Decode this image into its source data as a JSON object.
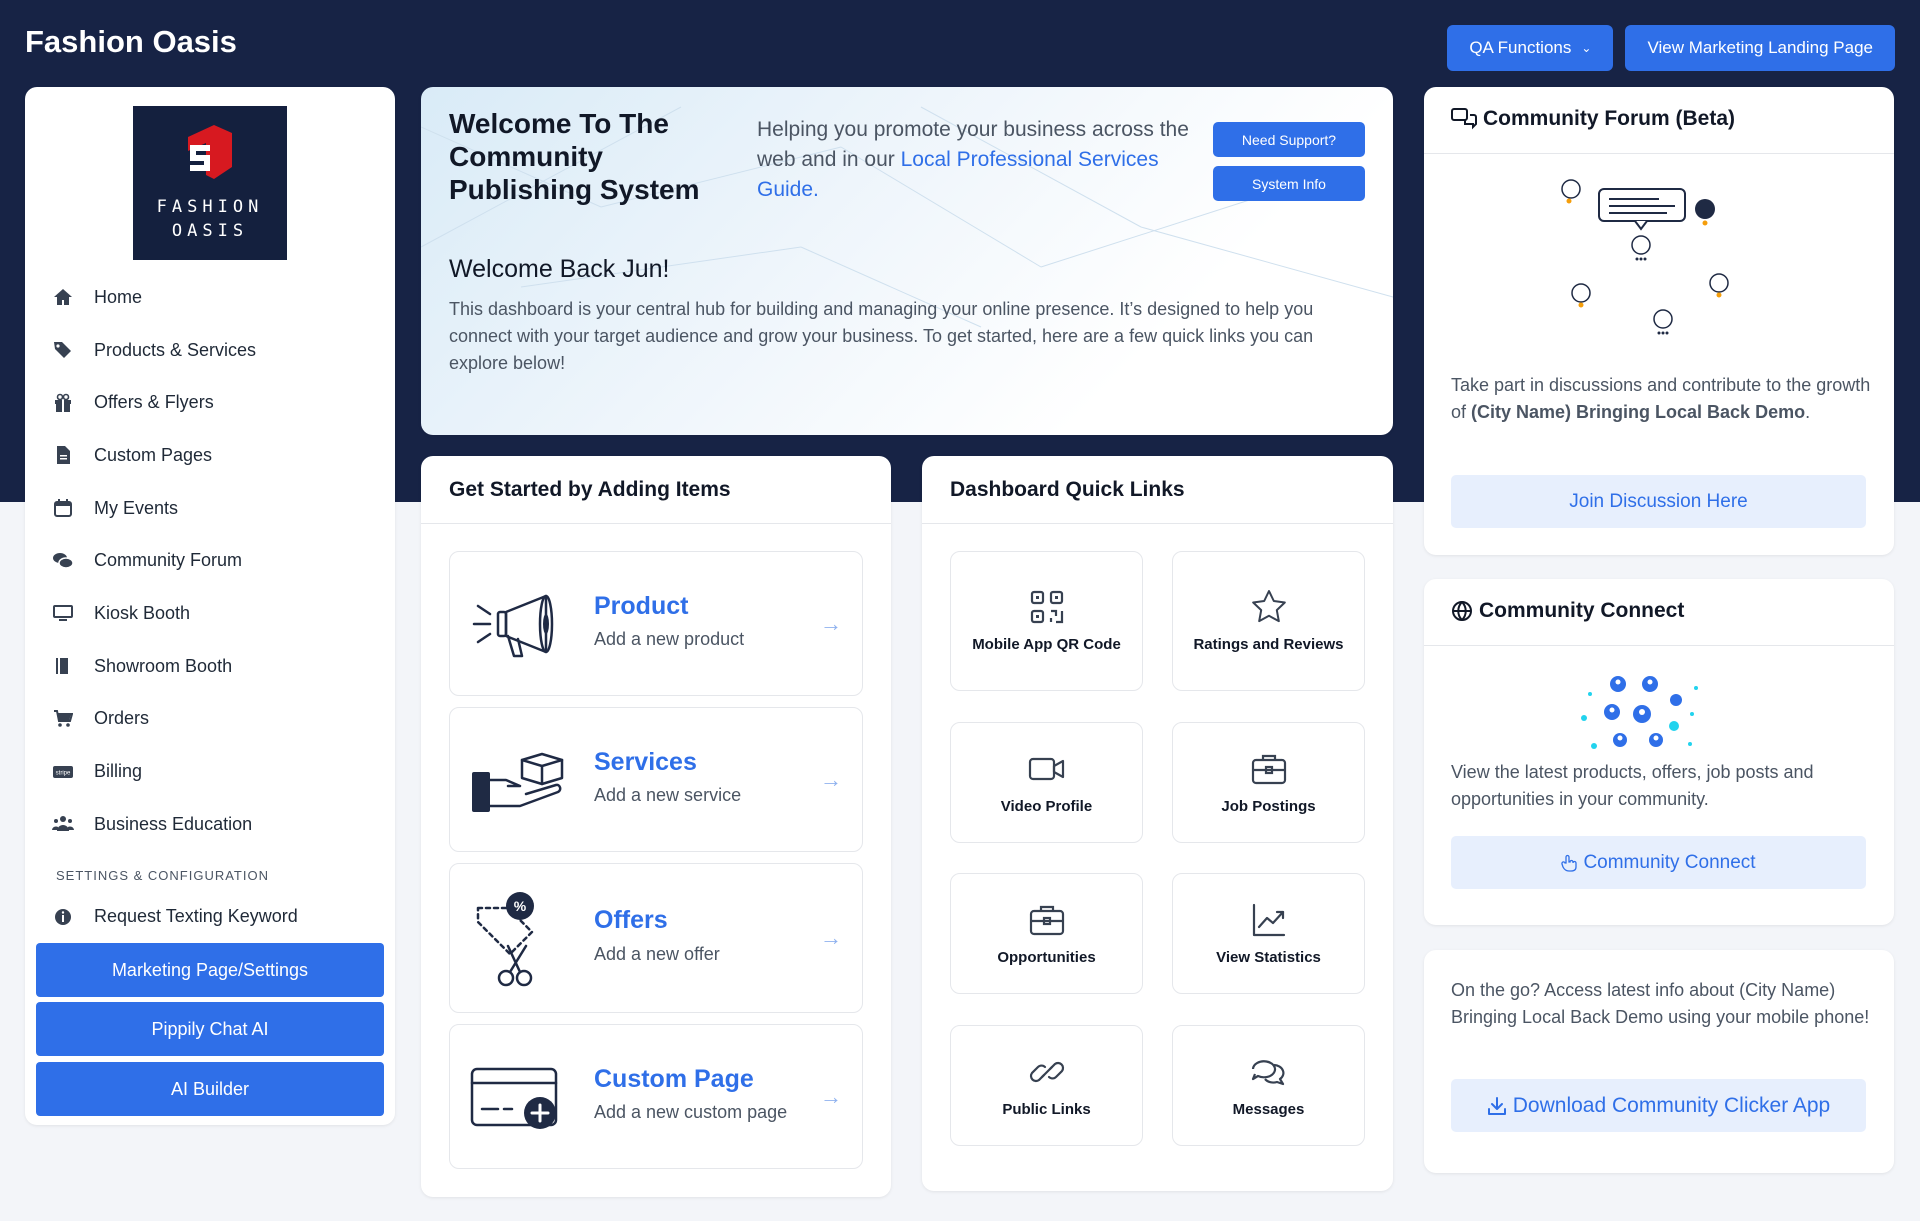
{
  "app": {
    "brand": "Fashion Oasis",
    "qa_label": "QA Functions",
    "landing_label": "View Marketing Landing Page"
  },
  "sidebar": {
    "logo_line1": "FASHION",
    "logo_line2": "OASIS",
    "items": [
      {
        "label": "Home",
        "icon": "home-icon"
      },
      {
        "label": "Products & Services",
        "icon": "tag-icon"
      },
      {
        "label": "Offers & Flyers",
        "icon": "gift-icon"
      },
      {
        "label": "Custom Pages",
        "icon": "file-icon"
      },
      {
        "label": "My Events",
        "icon": "calendar-icon"
      },
      {
        "label": "Community Forum",
        "icon": "comments-icon"
      },
      {
        "label": "Kiosk Booth",
        "icon": "monitor-icon"
      },
      {
        "label": "Showroom Booth",
        "icon": "book-icon"
      },
      {
        "label": "Orders",
        "icon": "cart-icon"
      },
      {
        "label": "Billing",
        "icon": "stripe-icon"
      },
      {
        "label": "Business Education",
        "icon": "users-icon"
      }
    ],
    "section_label": "SETTINGS & CONFIGURATION",
    "keyword_label": "Request Texting Keyword",
    "buttons": [
      "Marketing Page/Settings",
      "Pippily Chat AI",
      "AI Builder"
    ]
  },
  "welcome": {
    "title": "Welcome To The Community Publishing System",
    "tagline_pre": "Helping you promote your business across the web and in our ",
    "tagline_link": "Local Professional Services Guide.",
    "support_label": "Need Support?",
    "sysinfo_label": "System Info",
    "greeting": "Welcome Back Jun!",
    "description": "This dashboard is your central hub for building and managing your online presence. It’s designed to help you connect with your target audience and grow your business. To get started, here are a few quick links you can explore below!"
  },
  "get_started": {
    "title": "Get Started by Adding Items",
    "items": [
      {
        "title": "Product",
        "subtitle": "Add a new product",
        "icon": "megaphone-icon"
      },
      {
        "title": "Services",
        "subtitle": "Add a new service",
        "icon": "hand-box-icon"
      },
      {
        "title": "Offers",
        "subtitle": "Add a new offer",
        "icon": "coupon-scissors-icon"
      },
      {
        "title": "Custom Page",
        "subtitle": "Add a new custom page",
        "icon": "card-plus-icon"
      }
    ]
  },
  "quick_links": {
    "title": "Dashboard Quick Links",
    "items": [
      {
        "label": "Mobile App QR Code",
        "icon": "qr-code-icon"
      },
      {
        "label": "Ratings and Reviews",
        "icon": "star-icon"
      },
      {
        "label": "Video Profile",
        "icon": "video-icon"
      },
      {
        "label": "Job Postings",
        "icon": "briefcase-icon"
      },
      {
        "label": "Opportunities",
        "icon": "briefcase-icon"
      },
      {
        "label": "View Statistics",
        "icon": "chart-line-icon"
      },
      {
        "label": "Public Links",
        "icon": "link-icon"
      },
      {
        "label": "Messages",
        "icon": "chat-bubbles-icon"
      }
    ]
  },
  "forum": {
    "title": "Community Forum (Beta)",
    "text_pre": "Take part in discussions and contribute to the growth of ",
    "text_bold": "(City Name) Bringing Local Back Demo",
    "text_post": ".",
    "button": "Join Discussion Here"
  },
  "connect": {
    "title": "Community Connect",
    "text": "View the latest products, offers, job posts and opportunities in your community.",
    "button": "Community Connect"
  },
  "mobile": {
    "text": "On the go? Access latest info about (City Name) Bringing Local Back Demo using your mobile phone!",
    "button": "Download Community Clicker App"
  },
  "colors": {
    "header_bg": "#172345",
    "accent": "#2f6fe8",
    "light_button": "#e7effd"
  }
}
